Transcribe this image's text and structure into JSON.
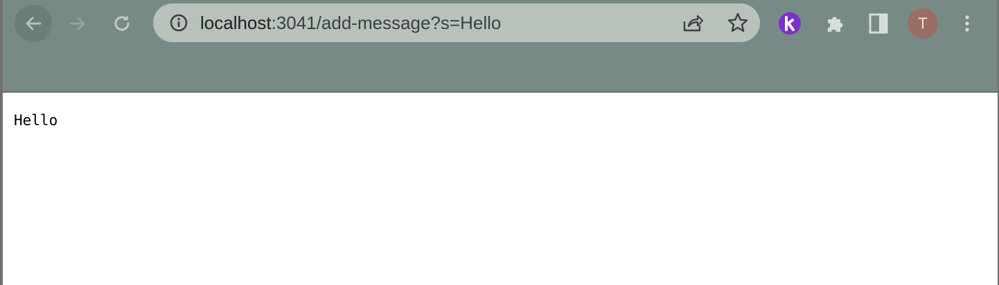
{
  "browser": {
    "url_host": "localhost",
    "url_path": ":3041/add-message?s=Hello",
    "avatar_letter": "T",
    "icons": {
      "back": "arrow-left-icon",
      "forward": "arrow-right-icon",
      "reload": "reload-icon",
      "info": "info-icon",
      "share": "share-icon",
      "bookmark": "star-icon",
      "extension": "k-extension-icon",
      "extensions": "puzzle-icon",
      "side_panel": "side-panel-icon",
      "menu": "kebab-menu-icon"
    },
    "colors": {
      "toolbar": "#778a86",
      "omnibox": "#b9c1bb",
      "extension_k": "#7b2fd0",
      "avatar": "#9a6e65"
    }
  },
  "page": {
    "message": "Hello"
  }
}
